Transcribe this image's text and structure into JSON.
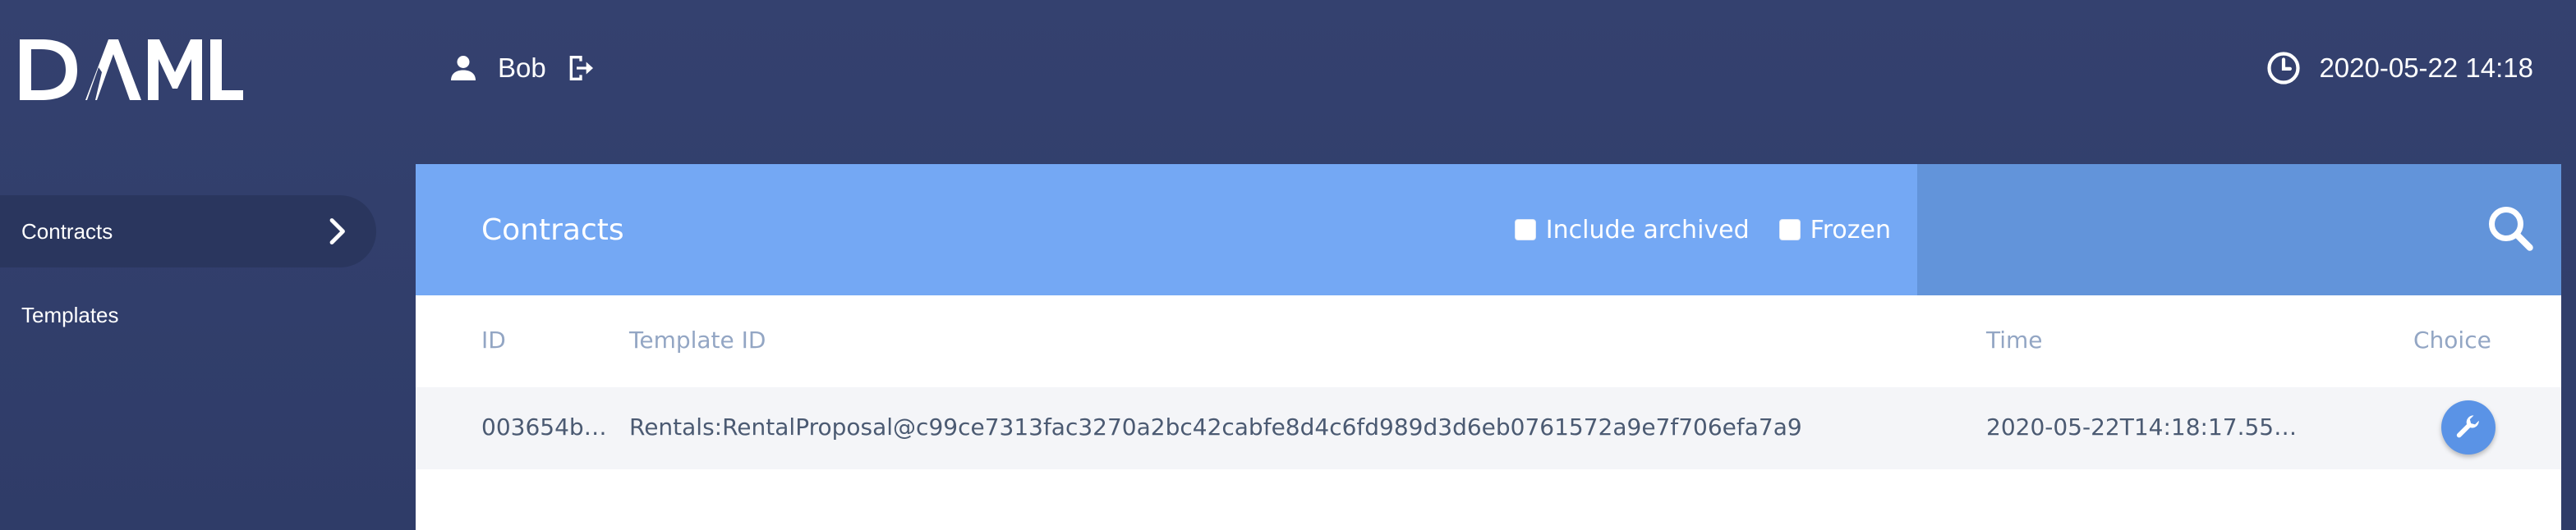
{
  "header": {
    "logo_text": "DAML",
    "user_name": "Bob",
    "clock": "2020-05-22 14:18"
  },
  "icons": {
    "user": "user-icon",
    "logout": "logout-icon",
    "clock": "clock-icon",
    "chevron": "chevron-right-icon",
    "search": "search-icon",
    "choice": "wrench-icon"
  },
  "colors": {
    "background": "#34416f",
    "sidebar_active": "#2a365e",
    "header_light": "#74a8f4",
    "header_dark": "#6294da",
    "choice_button": "#5a93e6",
    "column_header_text": "#93a6c4"
  },
  "sidebar": {
    "items": [
      {
        "label": "Contracts",
        "active": true
      },
      {
        "label": "Templates",
        "active": false
      }
    ]
  },
  "panel": {
    "title": "Contracts",
    "filters": {
      "include_archived": {
        "label": "Include archived",
        "checked": false
      },
      "frozen": {
        "label": "Frozen",
        "checked": false
      }
    }
  },
  "table": {
    "columns": [
      "ID",
      "Template ID",
      "Time",
      "Choice"
    ],
    "rows": [
      {
        "id": "003654b…",
        "template_id": "Rentals:RentalProposal@c99ce7313fac3270a2bc42cabfe8d4c6fd989d3d6eb0761572a9e7f706efa7a9",
        "time": "2020-05-22T14:18:17.55…"
      }
    ]
  }
}
